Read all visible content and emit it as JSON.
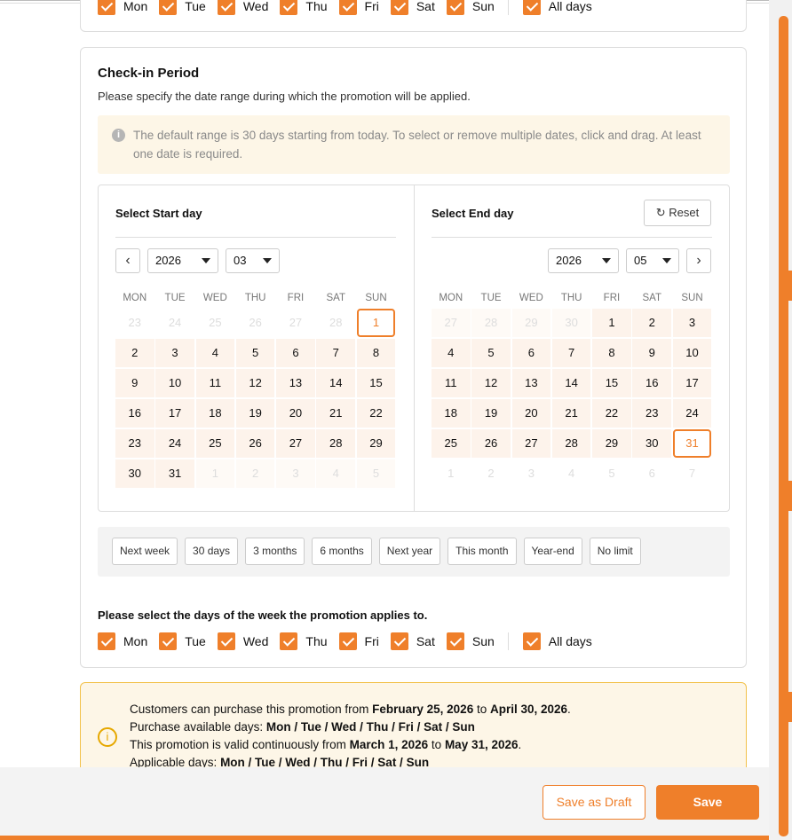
{
  "weekdays_short": [
    "Mon",
    "Tue",
    "Wed",
    "Thu",
    "Fri",
    "Sat",
    "Sun"
  ],
  "all_days": "All days",
  "checkin": {
    "title": "Check-in Period",
    "subtitle": "Please specify the date range during which the promotion will be applied.",
    "note": "The default range is 30 days starting from today. To select or remove multiple dates, click and drag. At least one date is required.",
    "start": {
      "title": "Select Start day",
      "year": "2026",
      "month": "03"
    },
    "end": {
      "title": "Select End day",
      "year": "2026",
      "month": "05",
      "reset": "Reset"
    },
    "col_headers": [
      "MON",
      "TUE",
      "WED",
      "THU",
      "FRI",
      "SAT",
      "SUN"
    ],
    "start_weeks": [
      [
        [
          23,
          "n"
        ],
        [
          24,
          "n"
        ],
        [
          25,
          "n"
        ],
        [
          26,
          "n"
        ],
        [
          27,
          "n"
        ],
        [
          28,
          "n"
        ],
        [
          1,
          "s"
        ]
      ],
      [
        [
          2,
          "r"
        ],
        [
          3,
          "r"
        ],
        [
          4,
          "r"
        ],
        [
          5,
          "r"
        ],
        [
          6,
          "r"
        ],
        [
          7,
          "r"
        ],
        [
          8,
          "r"
        ]
      ],
      [
        [
          9,
          "r"
        ],
        [
          10,
          "r"
        ],
        [
          11,
          "r"
        ],
        [
          12,
          "r"
        ],
        [
          13,
          "r"
        ],
        [
          14,
          "r"
        ],
        [
          15,
          "r"
        ]
      ],
      [
        [
          16,
          "r"
        ],
        [
          17,
          "r"
        ],
        [
          18,
          "r"
        ],
        [
          19,
          "r"
        ],
        [
          20,
          "r"
        ],
        [
          21,
          "r"
        ],
        [
          22,
          "r"
        ]
      ],
      [
        [
          23,
          "r"
        ],
        [
          24,
          "r"
        ],
        [
          25,
          "r"
        ],
        [
          26,
          "r"
        ],
        [
          27,
          "r"
        ],
        [
          28,
          "r"
        ],
        [
          29,
          "r"
        ]
      ],
      [
        [
          30,
          "r"
        ],
        [
          31,
          "r"
        ],
        [
          1,
          "f"
        ],
        [
          2,
          "f"
        ],
        [
          3,
          "f"
        ],
        [
          4,
          "f"
        ],
        [
          5,
          "f"
        ]
      ]
    ],
    "end_weeks": [
      [
        [
          27,
          "f"
        ],
        [
          28,
          "f"
        ],
        [
          29,
          "f"
        ],
        [
          30,
          "f"
        ],
        [
          1,
          "r"
        ],
        [
          2,
          "r"
        ],
        [
          3,
          "r"
        ]
      ],
      [
        [
          4,
          "r"
        ],
        [
          5,
          "r"
        ],
        [
          6,
          "r"
        ],
        [
          7,
          "r"
        ],
        [
          8,
          "r"
        ],
        [
          9,
          "r"
        ],
        [
          10,
          "r"
        ]
      ],
      [
        [
          11,
          "r"
        ],
        [
          12,
          "r"
        ],
        [
          13,
          "r"
        ],
        [
          14,
          "r"
        ],
        [
          15,
          "r"
        ],
        [
          16,
          "r"
        ],
        [
          17,
          "r"
        ]
      ],
      [
        [
          18,
          "r"
        ],
        [
          19,
          "r"
        ],
        [
          20,
          "r"
        ],
        [
          21,
          "r"
        ],
        [
          22,
          "r"
        ],
        [
          23,
          "r"
        ],
        [
          24,
          "r"
        ]
      ],
      [
        [
          25,
          "r"
        ],
        [
          26,
          "r"
        ],
        [
          27,
          "r"
        ],
        [
          28,
          "r"
        ],
        [
          29,
          "r"
        ],
        [
          30,
          "r"
        ],
        [
          31,
          "s"
        ]
      ],
      [
        [
          1,
          "n"
        ],
        [
          2,
          "n"
        ],
        [
          3,
          "n"
        ],
        [
          4,
          "n"
        ],
        [
          5,
          "n"
        ],
        [
          6,
          "n"
        ],
        [
          7,
          "n"
        ]
      ]
    ],
    "quick_ranges": [
      "Next week",
      "30 days",
      "3 months",
      "6 months",
      "Next year",
      "This month",
      "Year-end",
      "No limit"
    ],
    "days_label": "Please select the days of the week the promotion applies to."
  },
  "summary": {
    "l1a": "Customers can purchase this promotion from ",
    "l1b": "February 25, 2026",
    "l1c": " to ",
    "l1d": "April 30, 2026",
    "l1e": ".",
    "l2a": "Purchase available days: ",
    "l2b": "Mon / Tue / Wed / Thu / Fri / Sat / Sun",
    "l3a": "This promotion is valid continuously from ",
    "l3b": "March 1, 2026",
    "l3c": " to ",
    "l3d": "May 31, 2026",
    "l3e": ".",
    "l4a": "Applicable days: ",
    "l4b": "Mon / Tue / Wed / Thu / Fri / Sat / Sun"
  },
  "footer": {
    "draft": "Save as Draft",
    "save": "Save"
  },
  "accent": "#ef7f2a"
}
